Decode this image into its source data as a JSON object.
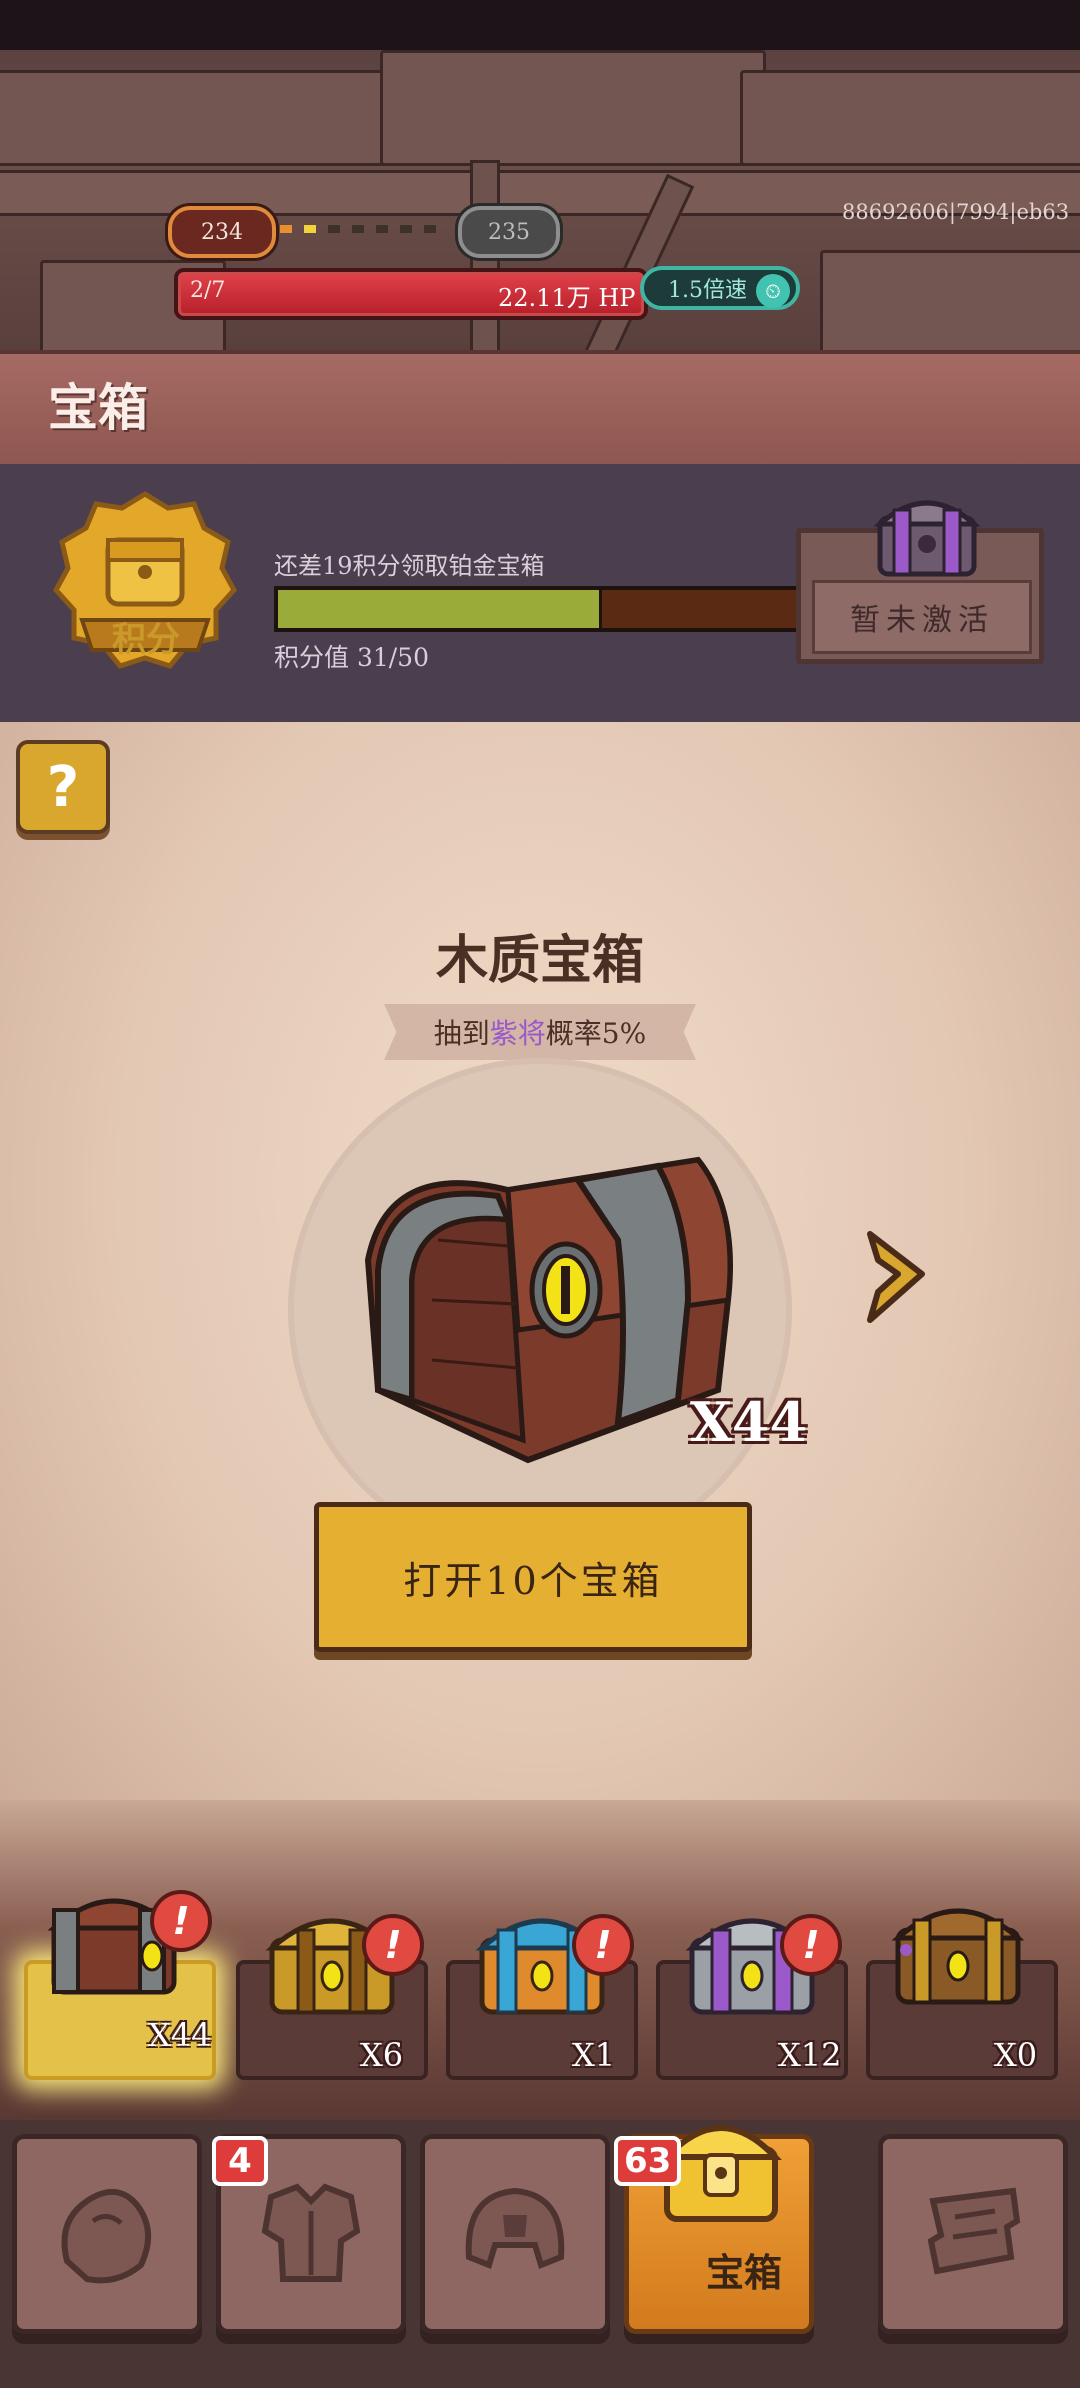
{
  "hud": {
    "current_level": "234",
    "next_level": "235",
    "stage": "2/7",
    "hp": "22.11万 HP",
    "speed": "1.5倍速",
    "build_id": "88692606|7994|eb63",
    "level_progress_dots": 7
  },
  "header": {
    "title": "宝箱"
  },
  "points": {
    "medal_label": "积分",
    "hint": "还差19积分领取铂金宝箱",
    "score_label": "积分值  31/50",
    "score_current": 31,
    "score_max": 50,
    "reward_status": "暂未激活"
  },
  "chest": {
    "help": "?",
    "name": "木质宝箱",
    "rate_prefix": "抽到",
    "rate_highlight": "紫将",
    "rate_suffix": "概率5%",
    "count": "X44",
    "open_button": "打开10个宝箱"
  },
  "chest_slots": [
    {
      "type": "wooden",
      "qty": "X44",
      "selected": true,
      "alert": true
    },
    {
      "type": "gold",
      "qty": "X6",
      "selected": false,
      "alert": true
    },
    {
      "type": "blue",
      "qty": "X1",
      "selected": false,
      "alert": true
    },
    {
      "type": "purple",
      "qty": "X12",
      "selected": false,
      "alert": true
    },
    {
      "type": "platinum",
      "qty": "X0",
      "selected": false,
      "alert": false
    }
  ],
  "nav": {
    "tabs": [
      {
        "icon": "gloves-icon",
        "badge": ""
      },
      {
        "icon": "armor-icon",
        "badge": "4"
      },
      {
        "icon": "helmet-icon",
        "badge": ""
      },
      {
        "icon": "chest-icon",
        "badge": "63",
        "label": "宝箱",
        "active": true
      },
      {
        "icon": "scroll-icon",
        "badge": ""
      }
    ]
  },
  "colors": {
    "accent_gold": "#e5af32",
    "hp_red": "#d2323c",
    "speed_teal": "#3fb6a4",
    "rate_purple": "#9b59c9",
    "progress_green": "#9aab3a"
  }
}
